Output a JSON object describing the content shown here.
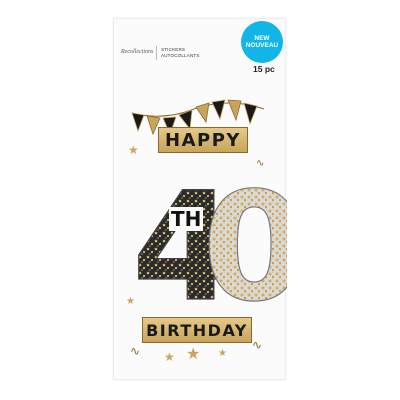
{
  "brand": "Recollections",
  "category_line1": "STICKERS",
  "category_line2": "AUTOCOLLANTS",
  "badge": {
    "line1": "NEW",
    "line2": "NOUVEAU"
  },
  "count": "15 pc",
  "stickers": {
    "happy": "HAPPY",
    "th": "TH",
    "birthday": "BIRTHDAY",
    "numeral_4": "4",
    "numeral_0": "0"
  },
  "colors": {
    "gold": "#c9a45b",
    "black": "#1a1a1a",
    "badge": "#12b6e6"
  }
}
